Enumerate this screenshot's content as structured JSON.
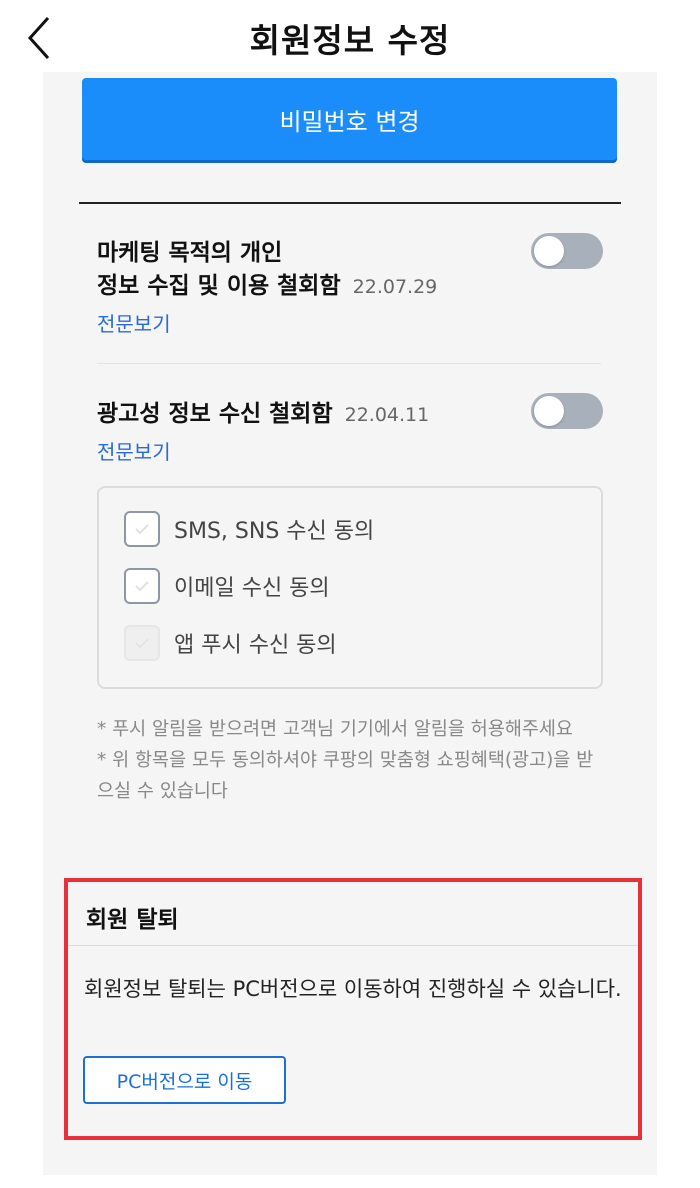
{
  "header": {
    "title": "회원정보 수정",
    "back_icon": "chevron-left-icon"
  },
  "password": {
    "button_label": "비밀번호 변경"
  },
  "marketing": {
    "title_line1": "마케팅 목적의 개인",
    "title_line2": "정보 수집 및 이용 철회함",
    "date": "22.07.29",
    "link": "전문보기",
    "toggle_on": false
  },
  "ads": {
    "title": "광고성 정보 수신 철회함",
    "date": "22.04.11",
    "link": "전문보기",
    "toggle_on": false,
    "options": [
      {
        "label": "SMS, SNS 수신 동의",
        "state": "unchecked"
      },
      {
        "label": "이메일 수신 동의",
        "state": "unchecked"
      },
      {
        "label": "앱 푸시 수신 동의",
        "state": "disabled"
      }
    ]
  },
  "notes": {
    "line1": "* 푸시 알림을 받으려면 고객님 기기에서 알림을 허용해주세요",
    "line2": "* 위 항목을 모두 동의하셔야 쿠팡의 맞춤형 쇼핑혜택(광고)을 받으실 수 있습니다"
  },
  "withdraw": {
    "title": "회원 탈퇴",
    "text": "회원정보 탈퇴는 PC버전으로 이동하여 진행하실 수 있습니다.",
    "button_label": "PC버전으로 이동"
  },
  "colors": {
    "accent": "#1a8dfb",
    "link": "#2a6ad8",
    "highlight_border": "#e8303a",
    "toggle_off": "#a8b0bb"
  }
}
